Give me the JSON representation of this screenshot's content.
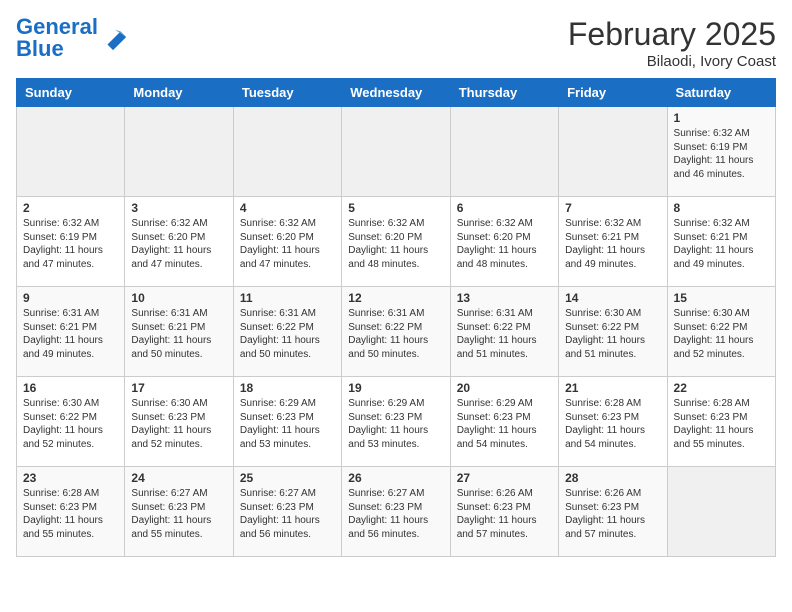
{
  "header": {
    "logo_text_general": "General",
    "logo_text_blue": "Blue",
    "main_title": "February 2025",
    "subtitle": "Bilaodi, Ivory Coast"
  },
  "weekdays": [
    "Sunday",
    "Monday",
    "Tuesday",
    "Wednesday",
    "Thursday",
    "Friday",
    "Saturday"
  ],
  "weeks": [
    [
      {
        "day": "",
        "empty": true
      },
      {
        "day": "",
        "empty": true
      },
      {
        "day": "",
        "empty": true
      },
      {
        "day": "",
        "empty": true
      },
      {
        "day": "",
        "empty": true
      },
      {
        "day": "",
        "empty": true
      },
      {
        "day": "1",
        "sunrise": "6:32 AM",
        "sunset": "6:19 PM",
        "daylight": "11 hours and 46 minutes."
      }
    ],
    [
      {
        "day": "2",
        "sunrise": "6:32 AM",
        "sunset": "6:19 PM",
        "daylight": "11 hours and 47 minutes."
      },
      {
        "day": "3",
        "sunrise": "6:32 AM",
        "sunset": "6:20 PM",
        "daylight": "11 hours and 47 minutes."
      },
      {
        "day": "4",
        "sunrise": "6:32 AM",
        "sunset": "6:20 PM",
        "daylight": "11 hours and 47 minutes."
      },
      {
        "day": "5",
        "sunrise": "6:32 AM",
        "sunset": "6:20 PM",
        "daylight": "11 hours and 48 minutes."
      },
      {
        "day": "6",
        "sunrise": "6:32 AM",
        "sunset": "6:20 PM",
        "daylight": "11 hours and 48 minutes."
      },
      {
        "day": "7",
        "sunrise": "6:32 AM",
        "sunset": "6:21 PM",
        "daylight": "11 hours and 49 minutes."
      },
      {
        "day": "8",
        "sunrise": "6:32 AM",
        "sunset": "6:21 PM",
        "daylight": "11 hours and 49 minutes."
      }
    ],
    [
      {
        "day": "9",
        "sunrise": "6:31 AM",
        "sunset": "6:21 PM",
        "daylight": "11 hours and 49 minutes."
      },
      {
        "day": "10",
        "sunrise": "6:31 AM",
        "sunset": "6:21 PM",
        "daylight": "11 hours and 50 minutes."
      },
      {
        "day": "11",
        "sunrise": "6:31 AM",
        "sunset": "6:22 PM",
        "daylight": "11 hours and 50 minutes."
      },
      {
        "day": "12",
        "sunrise": "6:31 AM",
        "sunset": "6:22 PM",
        "daylight": "11 hours and 50 minutes."
      },
      {
        "day": "13",
        "sunrise": "6:31 AM",
        "sunset": "6:22 PM",
        "daylight": "11 hours and 51 minutes."
      },
      {
        "day": "14",
        "sunrise": "6:30 AM",
        "sunset": "6:22 PM",
        "daylight": "11 hours and 51 minutes."
      },
      {
        "day": "15",
        "sunrise": "6:30 AM",
        "sunset": "6:22 PM",
        "daylight": "11 hours and 52 minutes."
      }
    ],
    [
      {
        "day": "16",
        "sunrise": "6:30 AM",
        "sunset": "6:22 PM",
        "daylight": "11 hours and 52 minutes."
      },
      {
        "day": "17",
        "sunrise": "6:30 AM",
        "sunset": "6:23 PM",
        "daylight": "11 hours and 52 minutes."
      },
      {
        "day": "18",
        "sunrise": "6:29 AM",
        "sunset": "6:23 PM",
        "daylight": "11 hours and 53 minutes."
      },
      {
        "day": "19",
        "sunrise": "6:29 AM",
        "sunset": "6:23 PM",
        "daylight": "11 hours and 53 minutes."
      },
      {
        "day": "20",
        "sunrise": "6:29 AM",
        "sunset": "6:23 PM",
        "daylight": "11 hours and 54 minutes."
      },
      {
        "day": "21",
        "sunrise": "6:28 AM",
        "sunset": "6:23 PM",
        "daylight": "11 hours and 54 minutes."
      },
      {
        "day": "22",
        "sunrise": "6:28 AM",
        "sunset": "6:23 PM",
        "daylight": "11 hours and 55 minutes."
      }
    ],
    [
      {
        "day": "23",
        "sunrise": "6:28 AM",
        "sunset": "6:23 PM",
        "daylight": "11 hours and 55 minutes."
      },
      {
        "day": "24",
        "sunrise": "6:27 AM",
        "sunset": "6:23 PM",
        "daylight": "11 hours and 55 minutes."
      },
      {
        "day": "25",
        "sunrise": "6:27 AM",
        "sunset": "6:23 PM",
        "daylight": "11 hours and 56 minutes."
      },
      {
        "day": "26",
        "sunrise": "6:27 AM",
        "sunset": "6:23 PM",
        "daylight": "11 hours and 56 minutes."
      },
      {
        "day": "27",
        "sunrise": "6:26 AM",
        "sunset": "6:23 PM",
        "daylight": "11 hours and 57 minutes."
      },
      {
        "day": "28",
        "sunrise": "6:26 AM",
        "sunset": "6:23 PM",
        "daylight": "11 hours and 57 minutes."
      },
      {
        "day": "",
        "empty": true
      }
    ]
  ]
}
